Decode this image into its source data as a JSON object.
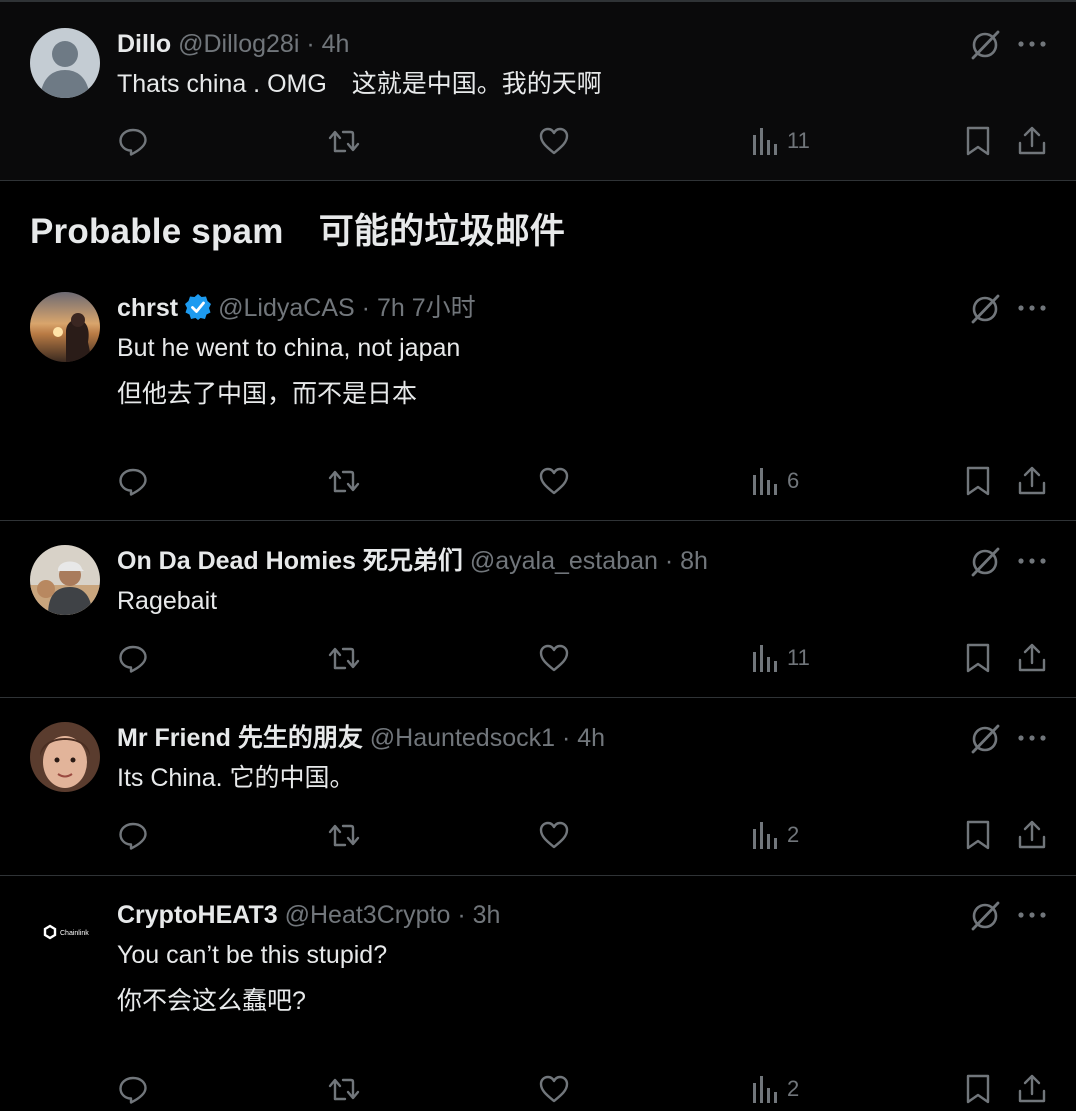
{
  "section_title": "Probable spam　可能的垃圾邮件",
  "colors": {
    "background": "#000000",
    "text": "#e7e9ea",
    "muted": "#71767b",
    "verified": "#1d9bf0",
    "divider": "#2f3336"
  },
  "posts": [
    {
      "display_name": "Dillo",
      "handle": "@Dillog28i",
      "separator": "·",
      "time": "4h",
      "lines": [
        "Thats china . OMG　这就是中国。我的天啊"
      ],
      "views": "11",
      "avatar": "default-avatar"
    },
    {
      "display_name": "chrst",
      "verified": true,
      "handle": "@LidyaCAS",
      "separator": "·",
      "time": "7h 7小时",
      "lines": [
        "But he went to china, not japan",
        "但他去了中国，而不是日本"
      ],
      "views": "6",
      "avatar": "sunset-photo-avatar"
    },
    {
      "display_name": "On Da Dead Homies 死兄弟们",
      "handle": "@ayala_estaban",
      "separator": "·",
      "time": "8h",
      "lines": [
        "Ragebait"
      ],
      "views": "11",
      "avatar": "man-in-cap-avatar"
    },
    {
      "display_name": "Mr Friend 先生的朋友",
      "handle": "@Hauntedsock1",
      "separator": "·",
      "time": "4h",
      "lines": [
        "Its China.  它的中国。"
      ],
      "views": "2",
      "avatar": "child-face-avatar"
    },
    {
      "display_name": "CryptoHEAT3",
      "handle": "@Heat3Crypto",
      "separator": "·",
      "time": "3h",
      "lines": [
        "You can’t be this stupid?",
        "你不会这么蠢吧?"
      ],
      "views": "2",
      "avatar": "chainlink-avatar",
      "avatar_label": "Chainlink"
    }
  ],
  "icons": {
    "reply": "reply-icon",
    "repost": "repost-icon",
    "like": "heart-icon",
    "views": "views-chart-icon",
    "bookmark": "bookmark-icon",
    "share": "share-icon",
    "grok": "grok-icon",
    "more": "more-icon"
  }
}
